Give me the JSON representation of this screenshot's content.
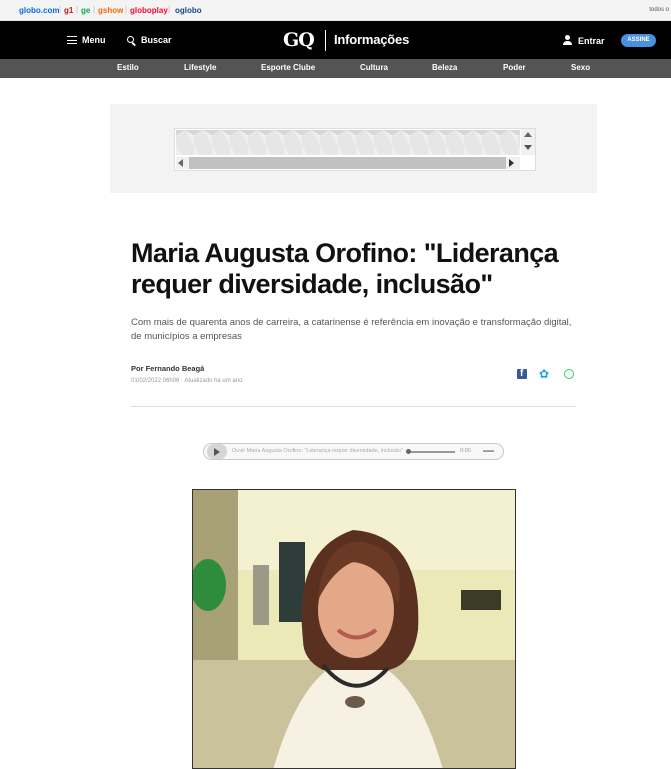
{
  "globo_bar": {
    "links": [
      {
        "label": "globo.com",
        "color": "#0669de"
      },
      {
        "label": "g1",
        "color": "#c4170c"
      },
      {
        "label": "ge",
        "color": "#06aa48"
      },
      {
        "label": "gshow",
        "color": "#ff6300"
      },
      {
        "label": "globoplay",
        "color": "#fb0234"
      },
      {
        "label": "oglobo",
        "color": "#1a4480"
      }
    ],
    "right_text": "todos o"
  },
  "header": {
    "menu_label": "Menu",
    "search_label": "Buscar",
    "logo": "GQ",
    "section_title": "Informações",
    "login_label": "Entrar",
    "subscribe_label": "ASSINE",
    "subscribe_color": "#4a90e2"
  },
  "nav": {
    "items": [
      {
        "label": "Estilo"
      },
      {
        "label": "Lifestyle"
      },
      {
        "label": "Esporte Clube"
      },
      {
        "label": "Cultura"
      },
      {
        "label": "Beleza"
      },
      {
        "label": "Poder"
      },
      {
        "label": "Sexo"
      }
    ]
  },
  "article": {
    "headline": "Maria Augusta Orofino: \"Liderança requer diversidade, inclusão\"",
    "subtitle": "Com mais de quarenta anos de carreira, a catarinense é referência em inovação e transformação digital, de municípios a empresas",
    "byline": "Por Fernando Beagá",
    "date": "01/02/2022 06h06 · Atualizado há um ano",
    "share": {
      "facebook_icon": "facebook-icon",
      "twitter_icon": "twitter-icon",
      "whatsapp_icon": "whatsapp-icon"
    }
  },
  "audio": {
    "label": "Ouvir   Maria Augusta Orofino: \"Liderança requer diversidade, inclusão\"",
    "time": "0:00",
    "progress": 0
  }
}
